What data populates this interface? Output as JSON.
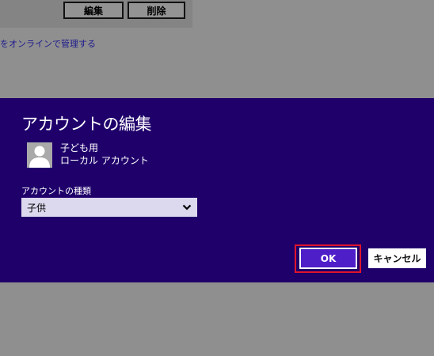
{
  "background": {
    "edit_button_label": "編集",
    "delete_button_label": "削除",
    "manage_link_text": "をオンラインで管理する"
  },
  "dialog": {
    "title": "アカウントの編集",
    "account_name": "子ども用",
    "account_kind": "ローカル アカウント",
    "account_type_label": "アカウントの種類",
    "account_type_value": "子供",
    "ok_label": "OK",
    "cancel_label": "キャンセル"
  },
  "colors": {
    "dialog_background": "#1f006b",
    "ok_button": "#4e1ec9",
    "highlight_frame": "#e0142c"
  },
  "icons": {
    "avatar": "user-silhouette-icon",
    "dropdown": "chevron-down-icon"
  }
}
